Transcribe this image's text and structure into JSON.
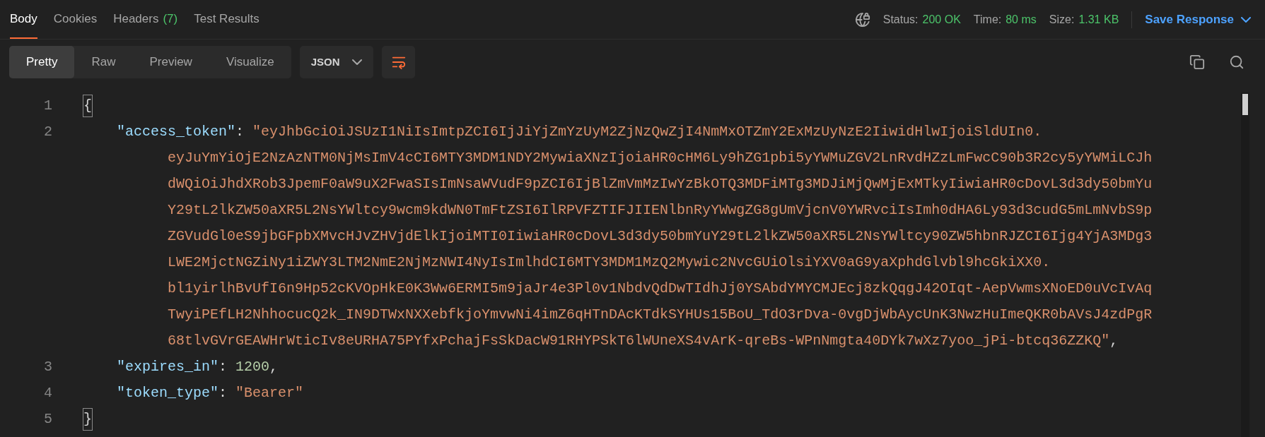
{
  "tabs": [
    {
      "label": "Body",
      "selected": true
    },
    {
      "label": "Cookies",
      "selected": false
    },
    {
      "label": "Headers",
      "count": "(7)",
      "selected": false
    },
    {
      "label": "Test Results",
      "selected": false
    }
  ],
  "response_info": [
    {
      "label": "Status:",
      "value": "200 OK"
    },
    {
      "label": "Time:",
      "value": "80 ms"
    },
    {
      "label": "Size:",
      "value": "1.31 KB"
    }
  ],
  "save_button": "Save Response",
  "view_modes": [
    {
      "label": "Pretty",
      "selected": true
    },
    {
      "label": "Raw",
      "selected": false
    },
    {
      "label": "Preview",
      "selected": false
    },
    {
      "label": "Visualize",
      "selected": false
    }
  ],
  "format": "JSON",
  "wrap_lines": true,
  "code_lines": [
    {
      "number": "1",
      "segments": [
        {
          "kind": "bracket",
          "text": "{"
        }
      ],
      "children": [
        {
          "number": "2",
          "segments": [
            {
              "kind": "key",
              "text": "\"access_token\""
            },
            {
              "kind": "punct",
              "text": ": "
            },
            {
              "kind": "string",
              "text": "\"eyJhbGciOiJSUzI1NiIsImtpZCI6IjJiYjZmYzUyM2ZjNzQwZjI4NmMxOTZmY2ExMzUyNzE2IiwidHlwIjoiSldUIn0."
            }
          ],
          "continuation": [
            {
              "kind": "string",
              "text": "eyJuYmYiOjE2NzAzNTM0NjMsImV4cCI6MTY3MDM1NDY2MywiaXNzIjoiaHR0cHM6Ly9hZG1pbi5yYWMuZGV2LnRvdHZzLmFwcC90b3R2cy5yYWMiLCJh"
            },
            {
              "kind": "string",
              "text": "dWQiOiJhdXRob3JpemF0aW9uX2FwaSIsImNsaWVudF9pZCI6IjBlZmVmMzIwYzBkOTQ3MDFiMTg3MDJiMjQwMjExMTkyIiwiaHR0cDovL3d3dy50bmYu"
            },
            {
              "kind": "string",
              "text": "Y29tL2lkZW50aXR5L2NsYWltcy9wcm9kdWN0TmFtZSI6IlRPVFZTIFJIIENlbnRyYWwgZG8gUmVjcnV0YWRvciIsImh0dHA6Ly93d3cudG5mLmNvbS9p"
            },
            {
              "kind": "string",
              "text": "ZGVudGl0eS9jbGFpbXMvcHJvZHVjdElkIjoiMTI0IiwiaHR0cDovL3d3dy50bmYuY29tL2lkZW50aXR5L2NsYWltcy90ZW5hbnRJZCI6Ijg4YjA3MDg3"
            },
            {
              "kind": "string",
              "text": "LWE2MjctNGZiNy1iZWY3LTM2NmE2NjMzNWI4NyIsImlhdCI6MTY3MDM1MzQ2Mywic2NvcGUiOlsiYXV0aG9yaXphdGlvbl9hcGkiXX0."
            },
            {
              "kind": "string",
              "text": "bl1yirlhBvUfI6n9Hp52cKVOpHkE0K3Ww6ERMI5m9jaJr4e3Pl0v1NbdvQdDwTIdhJj0YSAbdYMYCMJEcj8zkQqgJ42OIqt-AepVwmsXNoED0uVcIvAq"
            },
            {
              "kind": "string",
              "text": "TwyiPEfLH2NhhocucQ2k_IN9DTWxNXXebfkjoYmvwNi4imZ6qHTnDAcKTdkSYHUs15BoU_TdO3rDva-0vgDjWbAycUnK3NwzHuImeQKR0bAVsJ4zdPgR"
            },
            {
              "kind": "string",
              "text": "68tlvGVrGEAWHrWticIv8eURHA75PYfxPchajFsSkDacW91RHYPSkT6lWUneXS4vArK-qreBs-WPnNmgta40DYk7wXz7yoo_jPi-btcq36ZZKQ\"",
              "suffix": ","
            }
          ]
        },
        {
          "number": "3",
          "segments": [
            {
              "kind": "key",
              "text": "\"expires_in\""
            },
            {
              "kind": "punct",
              "text": ": "
            },
            {
              "kind": "number",
              "text": "1200"
            },
            {
              "kind": "punct",
              "text": ","
            }
          ]
        },
        {
          "number": "4",
          "segments": [
            {
              "kind": "key",
              "text": "\"token_type\""
            },
            {
              "kind": "punct",
              "text": ": "
            },
            {
              "kind": "string",
              "text": "\"Bearer\""
            }
          ]
        }
      ]
    },
    {
      "number": "5",
      "segments": [
        {
          "kind": "bracket",
          "text": "}"
        }
      ]
    }
  ]
}
